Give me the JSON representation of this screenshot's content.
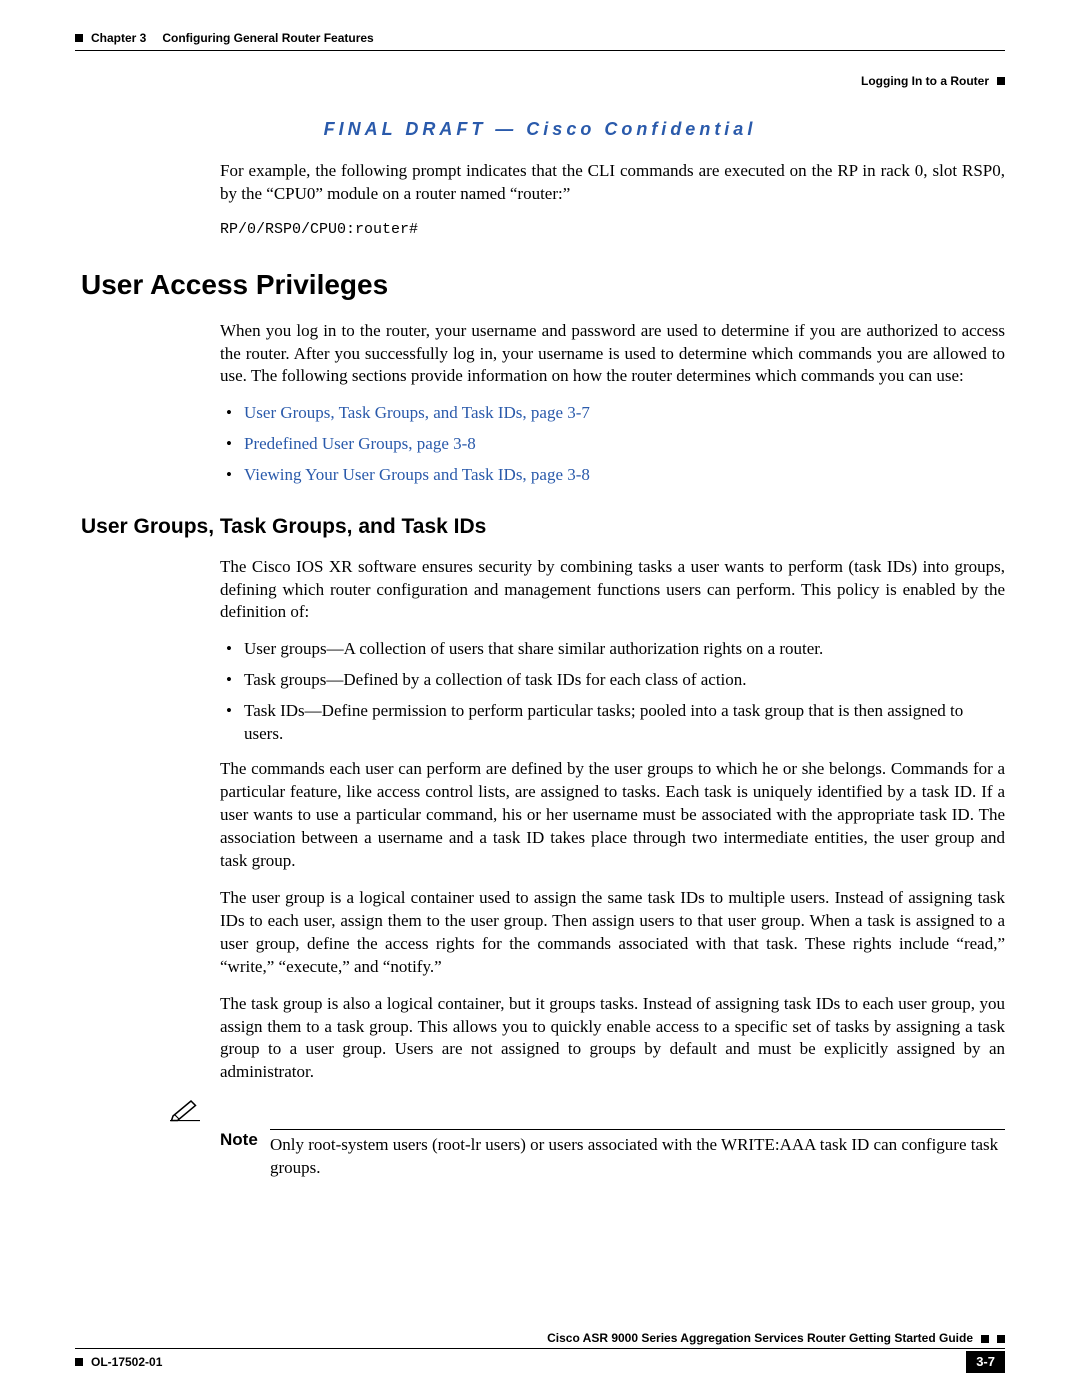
{
  "header": {
    "chapter_label": "Chapter 3",
    "chapter_title": "Configuring General Router Features",
    "section_right": "Logging In to a Router"
  },
  "confidential": "FINAL DRAFT — Cisco Confidential",
  "intro": {
    "para": "For example, the following prompt indicates that the CLI commands are executed on the RP in rack 0, slot RSP0, by the “CPU0” module on a router named “router:”",
    "code": "RP/0/RSP0/CPU0:router#"
  },
  "section1": {
    "heading": "User Access Privileges",
    "para": "When you log in to the router, your username and password are used to determine if you are authorized to access the router. After you successfully log in, your username is used to determine which commands you are allowed to use. The following sections provide information on how the router determines which commands you can use:",
    "links": [
      "User Groups, Task Groups, and Task IDs, page 3-7",
      "Predefined User Groups, page 3-8",
      "Viewing Your User Groups and Task IDs, page 3-8"
    ]
  },
  "section2": {
    "heading": "User Groups, Task Groups, and Task IDs",
    "para1": "The Cisco IOS XR software ensures security by combining tasks a user wants to perform (task IDs) into groups, defining which router configuration and management functions users can perform. This policy is enabled by the definition of:",
    "bullets": [
      "User groups—A collection of users that share similar authorization rights on a router.",
      "Task groups—Defined by a collection of task IDs for each class of action.",
      "Task IDs—Define permission to perform particular tasks; pooled into a task group that is then assigned to users."
    ],
    "para2": "The commands each user can perform are defined by the user groups to which he or she belongs. Commands for a particular feature, like access control lists, are assigned to tasks. Each task is uniquely identified by a task ID. If a user wants to use a particular command, his or her username must be associated with the appropriate task ID. The association between a username and a task ID takes place through two intermediate entities, the user group and task group.",
    "para3": "The user group is a logical container used to assign the same task IDs to multiple users. Instead of assigning task IDs to each user, assign them to the user group. Then assign users to that user group. When a task is assigned to a user group, define the access rights for the commands associated with that task. These rights include “read,” “write,” “execute,” and “notify.”",
    "para4": "The task group is also a logical container, but it groups tasks. Instead of assigning task IDs to each user group, you assign them to a task group. This allows you to quickly enable access to a specific set of tasks by assigning a task group to a user group. Users are not assigned to groups by default and must be explicitly assigned by an administrator."
  },
  "note": {
    "label": "Note",
    "text": "Only root-system users (root-lr users) or users associated with the WRITE:AAA task ID can configure task groups."
  },
  "footer": {
    "guide": "Cisco ASR 9000 Series Aggregation Services Router Getting Started Guide",
    "doc_id": "OL-17502-01",
    "page_num": "3-7"
  }
}
